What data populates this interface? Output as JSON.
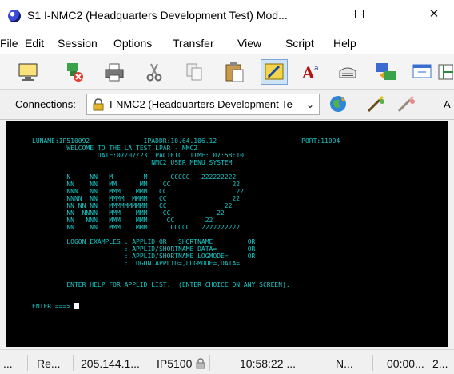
{
  "window": {
    "title": "S1 I-NMC2 (Headquarters Development Test) Mod..."
  },
  "window_controls": {
    "minimize": "",
    "maximize": "",
    "close": "✕"
  },
  "menu": [
    "File",
    "Edit",
    "Session",
    "Options",
    "Transfer",
    "View",
    "Script",
    "Help"
  ],
  "toolbar": {
    "icons": [
      "monitor-icon",
      "disconnect-icon",
      "print-icon",
      "cut-icon",
      "copy-icon",
      "paste-icon",
      "edit-icon",
      "font-icon",
      "keyboard-icon",
      "transfer-icon",
      "screen-icon",
      "layout-icon"
    ]
  },
  "connections": {
    "label": "Connections:",
    "selected": "I-NMC2 (Headquarters Development Te",
    "right_text": "A"
  },
  "terminal": {
    "lines": [
      "LUNAME:IP510092              IPADDR:10.64.106.12                      PORT:11004",
      "         WELCOME TO THE LA TEST LPAR - NMC2",
      "                 DATE:07/07/23  PACIFIC  TIME: 07:58:10",
      "                               NMC2 USER MENU SYSTEM",
      "",
      "         N     NN   M        M      CCCCC   222222222",
      "         NN    NN   MM      MM    CC                22",
      "         NNN   NN   MMM    MMM   CC                  22",
      "         NNNN  NN   MMMM  MMMM   CC                 22",
      "         NN NN NN   MMMMMMMMMM   CC               22",
      "         NN  NNNN   MMM    MMM    CC            22",
      "         NN   NNN   MMM    MMM     CC        22",
      "         NN    NN   MMM    MMM      CCCCC   2222222222",
      "",
      "         LOGON EXAMPLES : APPLID OR   SHORTNAME         OR",
      "                        : APPLID/SHORTNAME DATA=        OR",
      "                        : APPLID/SHORTNAME LOGMODE=     OR",
      "                        : LOGON APPLID=,LOGMODE=,DATA=",
      "",
      "",
      "         ENTER HELP FOR APPLID LIST.  (ENTER CHOICE ON ANY SCREEN).",
      "",
      "",
      "ENTER ===>"
    ]
  },
  "status": {
    "cells": [
      "...",
      "Re...",
      "205.144.1...",
      "IP5100",
      "10:58:22 ...",
      "N...",
      "00:00...",
      "2..."
    ]
  }
}
